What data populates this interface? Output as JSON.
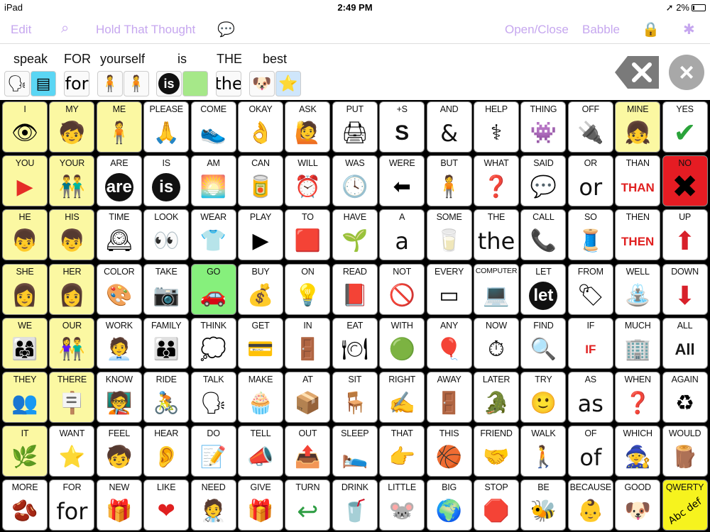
{
  "status": {
    "device": "iPad",
    "time": "2:49 PM",
    "battery": "2%"
  },
  "toolbar": {
    "edit": "Edit",
    "hold": "Hold That Thought",
    "openclose": "Open/Close",
    "babble": "Babble"
  },
  "message": [
    {
      "word": "speak",
      "icon": "🗣"
    },
    {
      "word": "FOR",
      "icon": "for"
    },
    {
      "word": "yourself",
      "icon": "🧍"
    },
    {
      "word": "is",
      "icon": "is"
    },
    {
      "word": "THE",
      "icon": "the"
    },
    {
      "word": "best",
      "icon": "⭐"
    }
  ],
  "grid": [
    [
      {
        "label": "I",
        "sym": "👁",
        "bg": "yellow"
      },
      {
        "label": "MY",
        "sym": "🧒",
        "bg": "yellow"
      },
      {
        "label": "ME",
        "sym": "🧍",
        "bg": "yellow"
      },
      {
        "label": "PLEASE",
        "sym": "🙏"
      },
      {
        "label": "COME",
        "sym": "👟"
      },
      {
        "label": "OKAY",
        "sym": "👌"
      },
      {
        "label": "ASK",
        "sym": "🙋"
      },
      {
        "label": "PUT",
        "sym": "🖨"
      },
      {
        "label": "+S",
        "sym": "S"
      },
      {
        "label": "AND",
        "sym": "&",
        "t": "txt"
      },
      {
        "label": "HELP",
        "sym": "⚕"
      },
      {
        "label": "THING",
        "sym": "👾"
      },
      {
        "label": "OFF",
        "sym": "🔌"
      },
      {
        "label": "MINE",
        "sym": "👧",
        "bg": "yellow"
      },
      {
        "label": "YES",
        "sym": "✔"
      }
    ],
    [
      {
        "label": "YOU",
        "sym": "▶",
        "bg": "yellow"
      },
      {
        "label": "YOUR",
        "sym": "👬",
        "bg": "yellow"
      },
      {
        "label": "ARE",
        "sym": "are",
        "t": "badge"
      },
      {
        "label": "IS",
        "sym": "is",
        "t": "badge"
      },
      {
        "label": "AM",
        "sym": "🌅"
      },
      {
        "label": "CAN",
        "sym": "🥫"
      },
      {
        "label": "WILL",
        "sym": "⏰"
      },
      {
        "label": "WAS",
        "sym": "🕓"
      },
      {
        "label": "WERE",
        "sym": "⬅"
      },
      {
        "label": "BUT",
        "sym": "🧍"
      },
      {
        "label": "WHAT",
        "sym": "❓"
      },
      {
        "label": "SAID",
        "sym": "💬"
      },
      {
        "label": "OR",
        "sym": "or",
        "t": "txt"
      },
      {
        "label": "THAN",
        "sym": "THAN",
        "t": "txtred"
      },
      {
        "label": "NO",
        "sym": "✖",
        "bg": "red"
      }
    ],
    [
      {
        "label": "HE",
        "sym": "👦",
        "bg": "yellow"
      },
      {
        "label": "HIS",
        "sym": "👦",
        "bg": "yellow"
      },
      {
        "label": "TIME",
        "sym": "🕰"
      },
      {
        "label": "LOOK",
        "sym": "👀"
      },
      {
        "label": "WEAR",
        "sym": "👕"
      },
      {
        "label": "PLAY",
        "sym": "▶"
      },
      {
        "label": "TO",
        "sym": "🟥"
      },
      {
        "label": "HAVE",
        "sym": "🌱"
      },
      {
        "label": "A",
        "sym": "a",
        "t": "txt"
      },
      {
        "label": "SOME",
        "sym": "🥛"
      },
      {
        "label": "THE",
        "sym": "the",
        "t": "txt"
      },
      {
        "label": "CALL",
        "sym": "📞"
      },
      {
        "label": "SO",
        "sym": "🧵"
      },
      {
        "label": "THEN",
        "sym": "THEN",
        "t": "txtred"
      },
      {
        "label": "UP",
        "sym": "⬆"
      }
    ],
    [
      {
        "label": "SHE",
        "sym": "👩",
        "bg": "yellow"
      },
      {
        "label": "HER",
        "sym": "👩",
        "bg": "yellow"
      },
      {
        "label": "COLOR",
        "sym": "🎨"
      },
      {
        "label": "TAKE",
        "sym": "📷"
      },
      {
        "label": "GO",
        "sym": "🚗",
        "bg": "green"
      },
      {
        "label": "BUY",
        "sym": "💰"
      },
      {
        "label": "ON",
        "sym": "💡"
      },
      {
        "label": "READ",
        "sym": "📕"
      },
      {
        "label": "NOT",
        "sym": "🚫"
      },
      {
        "label": "EVERY",
        "sym": "▭"
      },
      {
        "label": "COMPUTER",
        "sym": "💻"
      },
      {
        "label": "LET",
        "sym": "let",
        "t": "badge"
      },
      {
        "label": "FROM",
        "sym": "🏷"
      },
      {
        "label": "WELL",
        "sym": "⛲"
      },
      {
        "label": "DOWN",
        "sym": "⬇"
      }
    ],
    [
      {
        "label": "WE",
        "sym": "👨‍👩‍👧",
        "bg": "yellow"
      },
      {
        "label": "OUR",
        "sym": "👫",
        "bg": "yellow"
      },
      {
        "label": "WORK",
        "sym": "🧑‍💼"
      },
      {
        "label": "FAMILY",
        "sym": "👪"
      },
      {
        "label": "THINK",
        "sym": "💭"
      },
      {
        "label": "GET",
        "sym": "💳"
      },
      {
        "label": "IN",
        "sym": "🚪"
      },
      {
        "label": "EAT",
        "sym": "🍽"
      },
      {
        "label": "WITH",
        "sym": "🟢"
      },
      {
        "label": "ANY",
        "sym": "🎈"
      },
      {
        "label": "NOW",
        "sym": "⏱"
      },
      {
        "label": "FIND",
        "sym": "🔍"
      },
      {
        "label": "IF",
        "sym": "IF",
        "t": "txtred"
      },
      {
        "label": "MUCH",
        "sym": "🏢"
      },
      {
        "label": "ALL",
        "sym": "All"
      }
    ],
    [
      {
        "label": "THEY",
        "sym": "👥",
        "bg": "yellow"
      },
      {
        "label": "THERE",
        "sym": "🪧",
        "bg": "yellow"
      },
      {
        "label": "KNOW",
        "sym": "🧑‍🏫"
      },
      {
        "label": "RIDE",
        "sym": "🚴"
      },
      {
        "label": "TALK",
        "sym": "🗣"
      },
      {
        "label": "MAKE",
        "sym": "🧁"
      },
      {
        "label": "AT",
        "sym": "📦"
      },
      {
        "label": "SIT",
        "sym": "🪑"
      },
      {
        "label": "RIGHT",
        "sym": "✍"
      },
      {
        "label": "AWAY",
        "sym": "🚪"
      },
      {
        "label": "LATER",
        "sym": "🐊"
      },
      {
        "label": "TRY",
        "sym": "🙂"
      },
      {
        "label": "AS",
        "sym": "as",
        "t": "txt"
      },
      {
        "label": "WHEN",
        "sym": "❓"
      },
      {
        "label": "AGAIN",
        "sym": "♻"
      }
    ],
    [
      {
        "label": "IT",
        "sym": "🌿",
        "bg": "yellow"
      },
      {
        "label": "WANT",
        "sym": "⭐"
      },
      {
        "label": "FEEL",
        "sym": "🧒"
      },
      {
        "label": "HEAR",
        "sym": "👂"
      },
      {
        "label": "DO",
        "sym": "📝"
      },
      {
        "label": "TELL",
        "sym": "📣"
      },
      {
        "label": "OUT",
        "sym": "📤"
      },
      {
        "label": "SLEEP",
        "sym": "🛌"
      },
      {
        "label": "THAT",
        "sym": "👉"
      },
      {
        "label": "THIS",
        "sym": "🏀"
      },
      {
        "label": "FRIEND",
        "sym": "🤝"
      },
      {
        "label": "WALK",
        "sym": "🚶"
      },
      {
        "label": "OF",
        "sym": "of",
        "t": "txt"
      },
      {
        "label": "WHICH",
        "sym": "🧙"
      },
      {
        "label": "WOULD",
        "sym": "🪵"
      }
    ],
    [
      {
        "label": "MORE",
        "sym": "🫘"
      },
      {
        "label": "FOR",
        "sym": "for",
        "t": "txt"
      },
      {
        "label": "NEW",
        "sym": "🎁"
      },
      {
        "label": "LIKE",
        "sym": "❤"
      },
      {
        "label": "NEED",
        "sym": "🧑‍⚕️"
      },
      {
        "label": "GIVE",
        "sym": "🎁"
      },
      {
        "label": "TURN",
        "sym": "↩"
      },
      {
        "label": "DRINK",
        "sym": "🥤"
      },
      {
        "label": "LITTLE",
        "sym": "🐭"
      },
      {
        "label": "BIG",
        "sym": "🌍"
      },
      {
        "label": "STOP",
        "sym": "🛑"
      },
      {
        "label": "BE",
        "sym": "🐝"
      },
      {
        "label": "BECAUSE",
        "sym": "👶"
      },
      {
        "label": "GOOD",
        "sym": "🐶"
      },
      {
        "label": "QWERTY",
        "sym": "Abc def",
        "bg": "yellowbright"
      }
    ]
  ]
}
